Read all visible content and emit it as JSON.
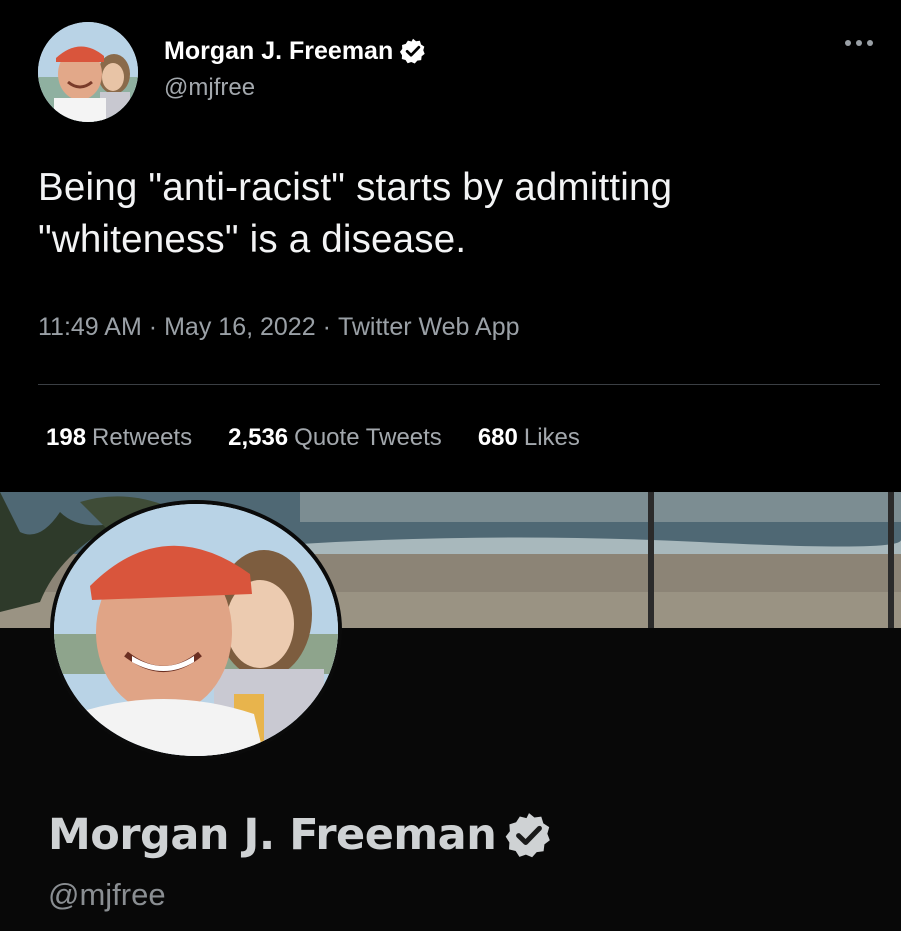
{
  "tweet": {
    "author": {
      "name": "Morgan J. Freeman",
      "handle": "@mjfree",
      "verified": true
    },
    "more_icon": "more-horizontal-icon",
    "text": "Being \"anti-racist\" starts by admitting \"whiteness\" is a disease.",
    "time": "11:49 AM",
    "date": "May 16, 2022",
    "source": "Twitter Web App",
    "separator": "·",
    "stats": {
      "retweets_count": "198",
      "retweets_label": "Retweets",
      "quotes_count": "2,536",
      "quotes_label": "Quote Tweets",
      "likes_count": "680",
      "likes_label": "Likes"
    }
  },
  "profile": {
    "name": "Morgan J. Freeman",
    "handle": "@mjfree",
    "verified": true
  },
  "colors": {
    "background": "#000000",
    "text_primary": "#e7e9ea",
    "text_secondary": "#a3a8ad",
    "hat": "#d9553c",
    "verified_badge": "#ffffff"
  }
}
